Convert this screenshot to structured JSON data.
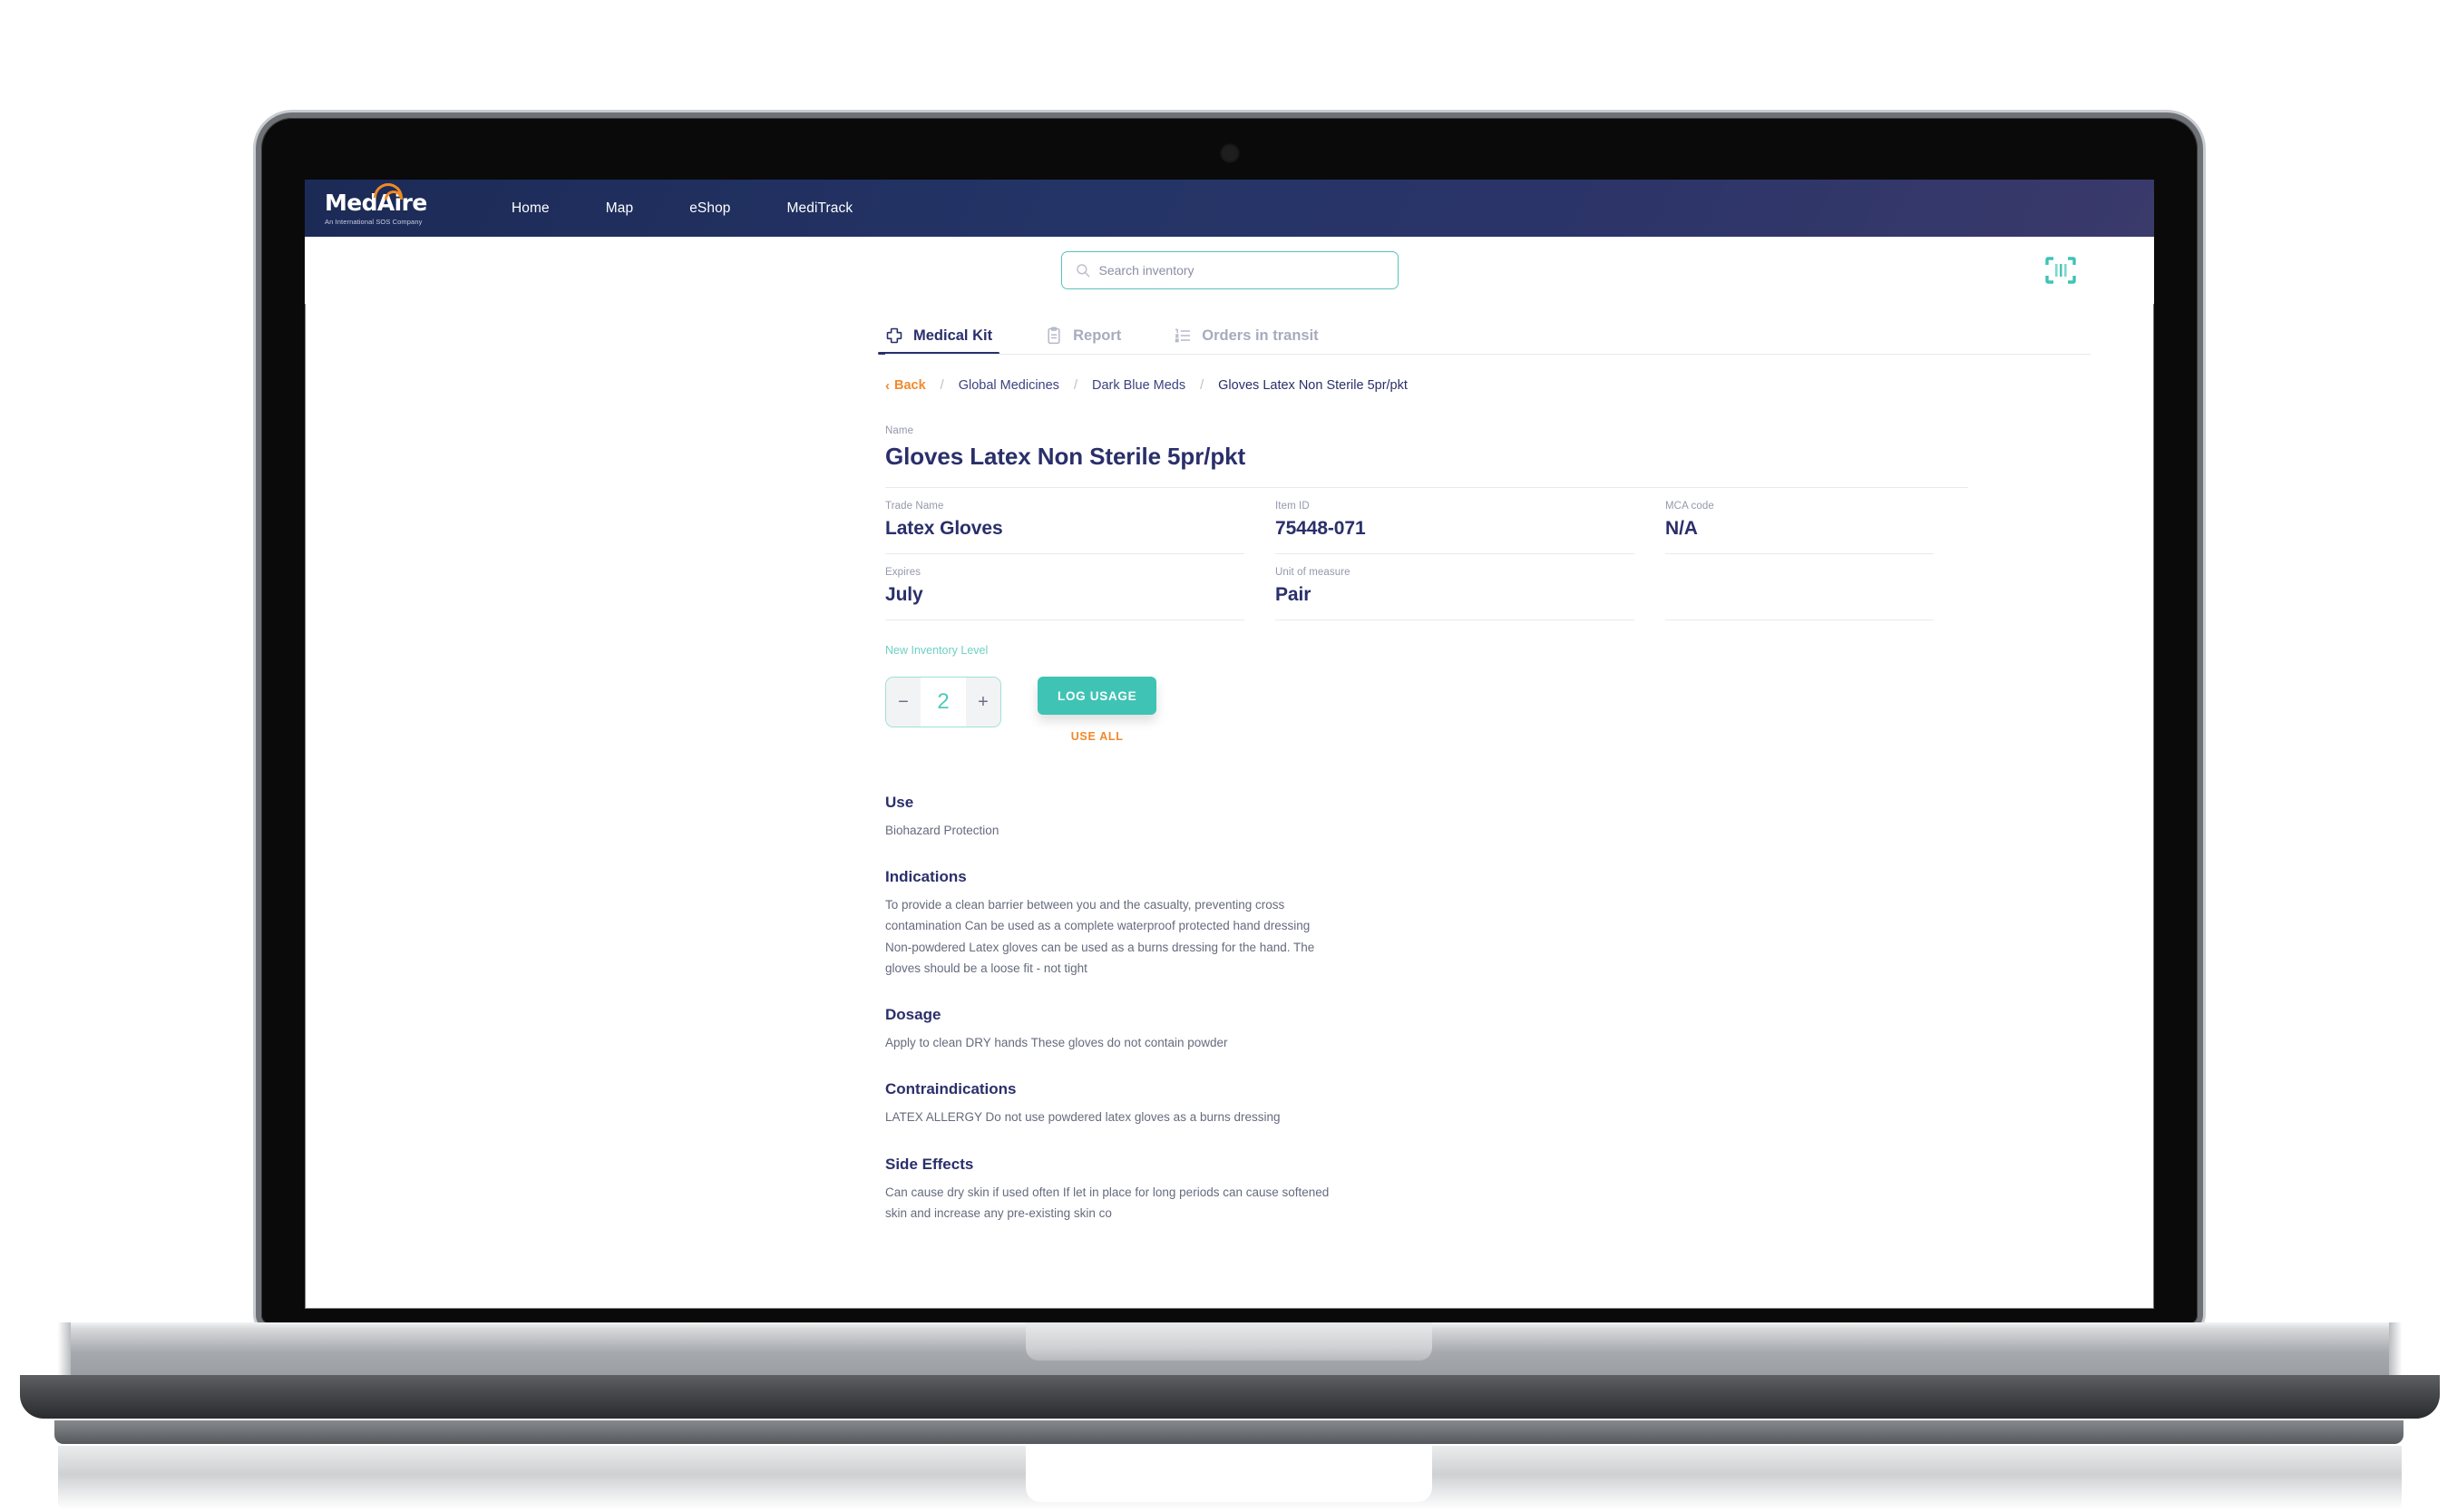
{
  "brand": {
    "logo_name": "MedAire",
    "logo_tagline": "An International SOS Company"
  },
  "navbar": {
    "links": [
      {
        "label": "Home"
      },
      {
        "label": "Map"
      },
      {
        "label": "eShop"
      },
      {
        "label": "MediTrack"
      }
    ]
  },
  "toolbar": {
    "search_placeholder": "Search inventory",
    "search_value": "",
    "scan_icon": "barcode-scan-icon"
  },
  "tabs": [
    {
      "label": "Medical Kit",
      "icon": "medical-cross-icon",
      "active": true
    },
    {
      "label": "Report",
      "icon": "clipboard-icon",
      "active": false
    },
    {
      "label": "Orders in transit",
      "icon": "ordered-list-icon",
      "active": false
    }
  ],
  "breadcrumb": {
    "back_label": "Back",
    "back_chevron": "‹",
    "separator": "/",
    "items": [
      {
        "label": "Global Medicines"
      },
      {
        "label": "Dark Blue Meds"
      },
      {
        "label": "Gloves Latex Non Sterile 5pr/pkt"
      }
    ]
  },
  "item": {
    "name_label": "Name",
    "name_value": "Gloves Latex Non Sterile 5pr/pkt",
    "fields": [
      {
        "label": "Trade Name",
        "value": "Latex Gloves"
      },
      {
        "label": "Item ID",
        "value": "75448-071"
      },
      {
        "label": "MCA code",
        "value": "N/A"
      },
      {
        "label": "Expires",
        "value": "July"
      },
      {
        "label": "Unit of measure",
        "value": "Pair"
      }
    ]
  },
  "inventory": {
    "level_label": "New Inventory Level",
    "decrement_label": "−",
    "quantity": "2",
    "increment_label": "+",
    "log_usage_label": "LOG USAGE",
    "use_all_label": "USE ALL"
  },
  "sections": [
    {
      "title": "Use",
      "body": "Biohazard Protection"
    },
    {
      "title": "Indications",
      "body": "To provide a clean barrier between you and the casualty, preventing cross contamination Can be used as a complete waterproof protected hand dressing Non-powdered Latex gloves can be used as a burns dressing for the hand. The gloves should be a loose fit - not tight"
    },
    {
      "title": "Dosage",
      "body": "Apply to clean DRY hands These gloves do not contain powder"
    },
    {
      "title": "Contraindications",
      "body": "LATEX ALLERGY Do not use powdered latex gloves as a burns dressing"
    },
    {
      "title": "Side Effects",
      "body": "Can cause dry skin if used often If let in place for long periods can cause softened skin and increase any pre-existing skin co"
    }
  ],
  "colors": {
    "navy": "#2a2f6b",
    "teal": "#3fc3b4",
    "orange": "#f2892b",
    "muted": "#9498ad"
  }
}
